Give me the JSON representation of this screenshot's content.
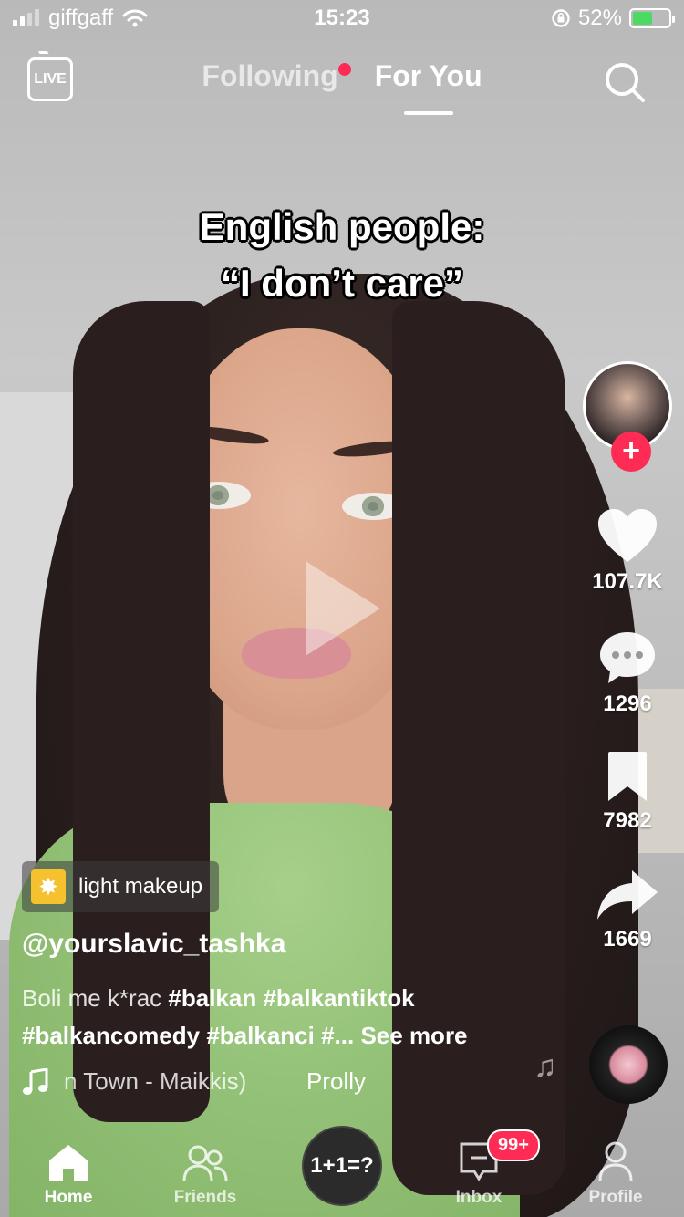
{
  "status_bar": {
    "carrier": "giffgaff",
    "time": "15:23",
    "battery_percent": "52%"
  },
  "top_nav": {
    "live_label": "LIVE",
    "tab_following": "Following",
    "tab_for_you": "For You",
    "active_tab": "For You"
  },
  "video": {
    "caption_line1": "English people:",
    "caption_line2": "“I don’t care”"
  },
  "rail": {
    "likes": "107.7K",
    "comments": "1296",
    "bookmarks": "7982",
    "shares": "1669"
  },
  "info": {
    "effect_label": "light makeup",
    "username": "@yourslavic_tashka",
    "desc_text": "Boli me k*rac ",
    "desc_tag1": "#balkan",
    "desc_tag2": "#balkantiktok",
    "desc_tag3": "#balkancomedy",
    "desc_tag4": "#balkanci",
    "desc_ellipsis": "#...",
    "see_more": "See more",
    "music_song": "n Town - Maikkis)",
    "music_artist": "Prolly"
  },
  "tabbar": {
    "home": "Home",
    "friends": "Friends",
    "center": "1+1=?",
    "inbox": "Inbox",
    "inbox_badge": "99+",
    "profile": "Profile"
  },
  "colors": {
    "accent": "#fe2c55",
    "battery": "#4cd964",
    "effect_icon": "#f6c12f"
  }
}
